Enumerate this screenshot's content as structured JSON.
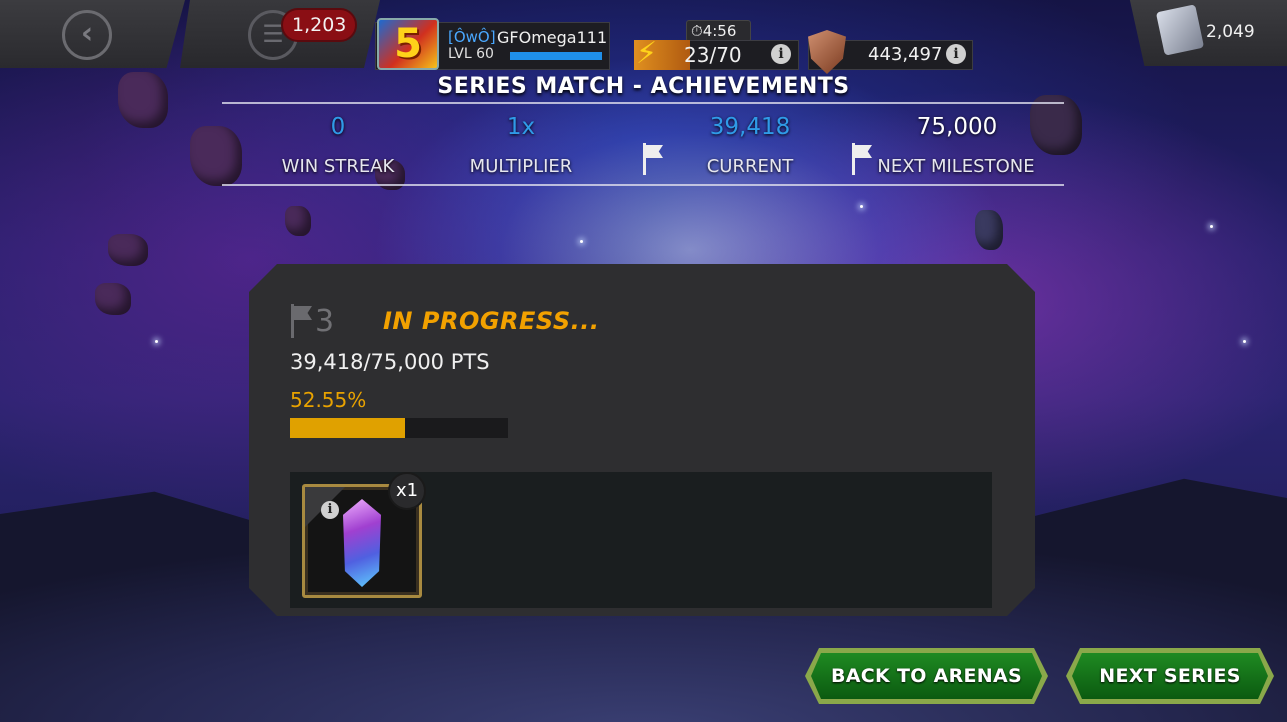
{
  "topbar": {
    "notification_count": "1,203",
    "clan_tag": "[ÔwÔ]",
    "player_name": "GFOmega111",
    "level": "LVL 60",
    "avatar_glyph": "5",
    "timer": "⏱4:56",
    "energy": "23/70",
    "rating": "443,497",
    "units": "2,049",
    "info_glyph": "i"
  },
  "header": {
    "title": "SERIES MATCH - ACHIEVEMENTS",
    "stats": [
      {
        "value": "0",
        "label": "WIN STREAK",
        "color": "#2f9be8"
      },
      {
        "value": "1x",
        "label": "MULTIPLIER",
        "color": "#2f9be8"
      },
      {
        "value": "39,418",
        "label": "CURRENT",
        "color": "#2f9be8"
      },
      {
        "value": "75,000",
        "label": "NEXT MILESTONE",
        "color": "#ffffff"
      }
    ]
  },
  "milestone": {
    "number": "3",
    "status": "IN PROGRESS...",
    "points": "39,418/75,000 PTS",
    "percent_text": "52.55%",
    "progress_fraction": 0.5255
  },
  "rewards": [
    {
      "icon": "crystal-icon",
      "quantity": "x1"
    }
  ],
  "buttons": {
    "back": "BACK TO ARENAS",
    "next": "NEXT SERIES"
  },
  "colors": {
    "accent_gold": "#f2a100",
    "stat_blue": "#2f9be8",
    "button_green": "#1f8a22"
  }
}
